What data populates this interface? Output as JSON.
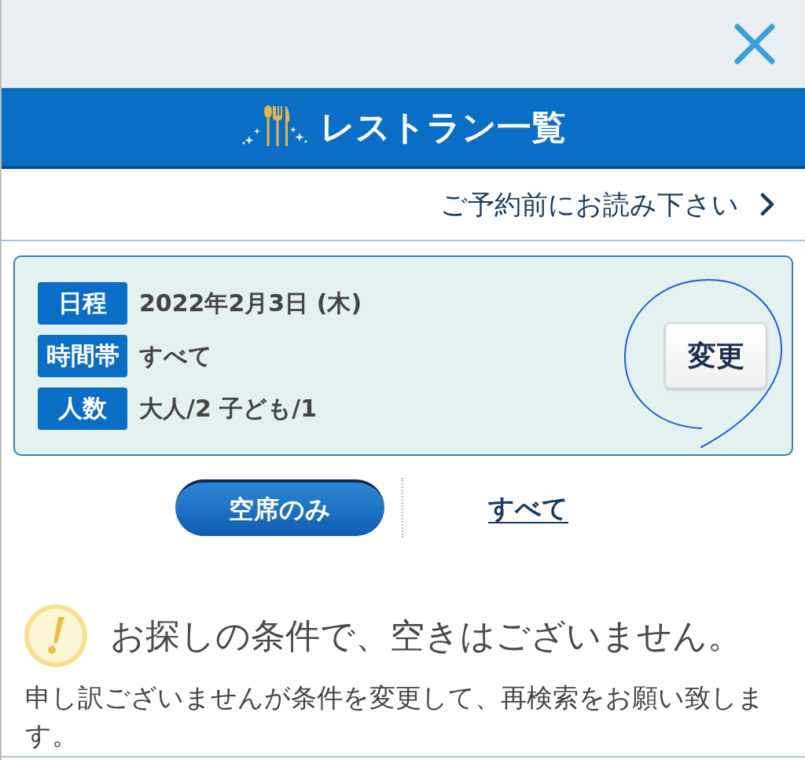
{
  "header": {
    "title": "レストラン一覧"
  },
  "notice_link": {
    "label": "ご予約前にお読み下さい"
  },
  "conditions": {
    "rows": [
      {
        "label": "日程",
        "value": "2022年2月3日 (木)"
      },
      {
        "label": "時間帯",
        "value": "すべて"
      },
      {
        "label": "人数",
        "value": "大人/2 子ども/1"
      }
    ],
    "change_button": "変更"
  },
  "filter_tabs": [
    {
      "label": "空席のみ",
      "selected": true
    },
    {
      "label": "すべて",
      "selected": false
    }
  ],
  "result": {
    "heading": "お探しの条件で、空きはございません。",
    "message": "申し訳ございませんが条件を変更して、再検索をお願い致します。"
  }
}
